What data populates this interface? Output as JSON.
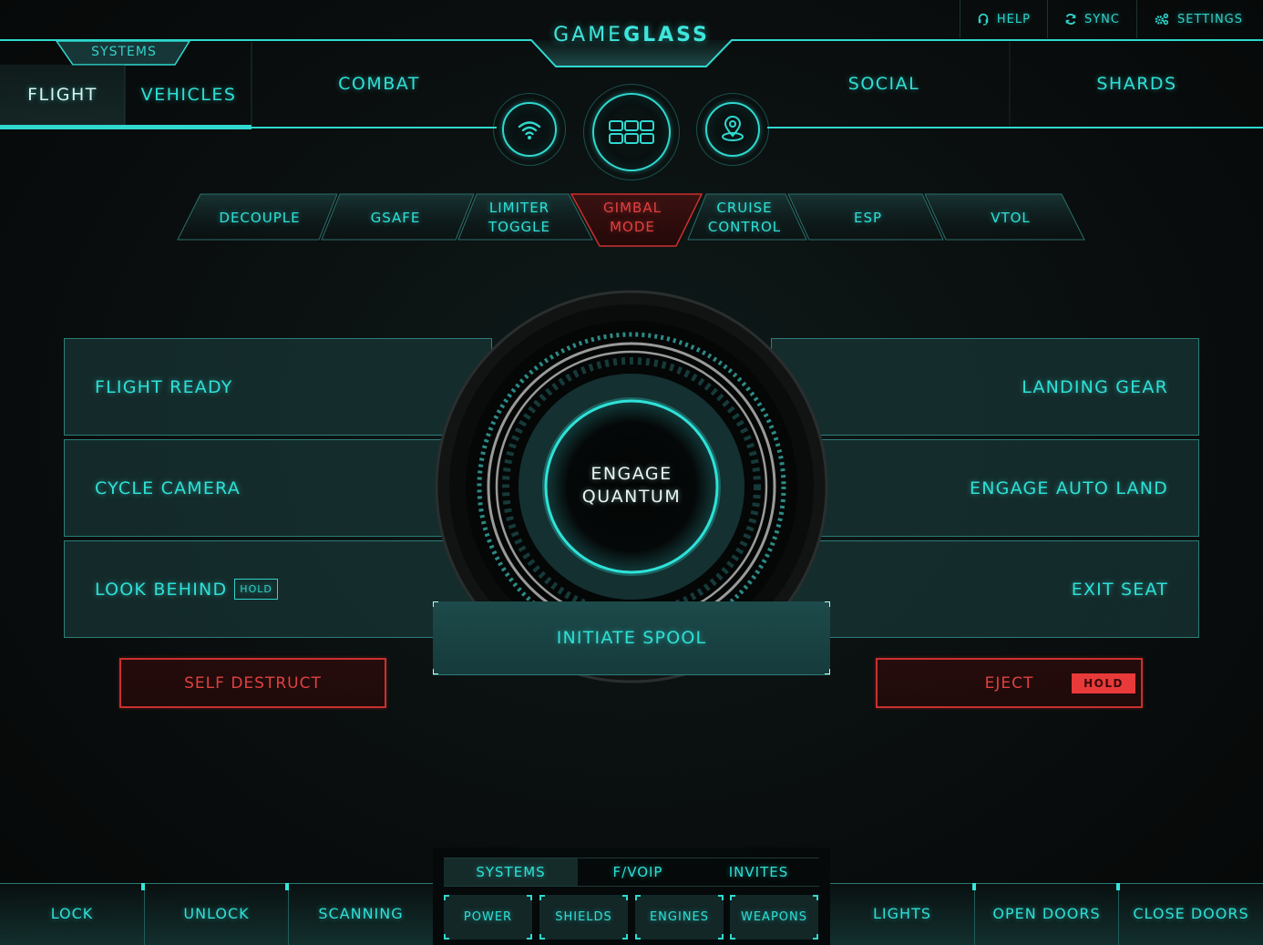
{
  "app": {
    "brand_light": "GAME",
    "brand_bold": "GLASS"
  },
  "utility": [
    {
      "label": "HELP",
      "icon": "headset-icon"
    },
    {
      "label": "SYNC",
      "icon": "sync-icon"
    },
    {
      "label": "SETTINGS",
      "icon": "gears-icon"
    }
  ],
  "nav": {
    "group_label": "SYSTEMS",
    "tabs": [
      {
        "label": "FLIGHT",
        "active": true
      },
      {
        "label": "VEHICLES",
        "active": false
      },
      {
        "label": "COMBAT",
        "active": false
      },
      {
        "label": "SOCIAL",
        "active": false
      },
      {
        "label": "SHARDS",
        "active": false
      }
    ],
    "center_icons": [
      "wifi-icon",
      "grid-icon",
      "map-pin-icon"
    ]
  },
  "toggles": [
    {
      "line1": "DECOUPLE",
      "line2": "",
      "state": "normal"
    },
    {
      "line1": "GSAFE",
      "line2": "",
      "state": "normal"
    },
    {
      "line1": "LIMITER",
      "line2": "TOGGLE",
      "state": "normal"
    },
    {
      "line1": "GIMBAL",
      "line2": "MODE",
      "state": "alert"
    },
    {
      "line1": "CRUISE",
      "line2": "CONTROL",
      "state": "normal"
    },
    {
      "line1": "ESP",
      "line2": "",
      "state": "normal"
    },
    {
      "line1": "VTOL",
      "line2": "",
      "state": "normal"
    }
  ],
  "panels": {
    "left": [
      {
        "label": "FLIGHT READY"
      },
      {
        "label": "CYCLE CAMERA"
      },
      {
        "label": "LOOK BEHIND",
        "badge": "HOLD"
      }
    ],
    "right": [
      {
        "label": "LANDING GEAR"
      },
      {
        "label": "ENGAGE AUTO LAND"
      },
      {
        "label": "EXIT SEAT"
      }
    ]
  },
  "quantum": {
    "line1": "ENGAGE",
    "line2": "QUANTUM",
    "spool_label": "INITIATE SPOOL"
  },
  "danger": {
    "self_destruct": "SELF DESTRUCT",
    "eject": "EJECT",
    "eject_badge": "HOLD"
  },
  "bottom": {
    "left": [
      "LOCK",
      "UNLOCK",
      "SCANNING"
    ],
    "right": [
      "LIGHTS",
      "OPEN DOORS",
      "CLOSE DOORS"
    ],
    "tabs": [
      {
        "label": "SYSTEMS",
        "active": true
      },
      {
        "label": "F/VOIP",
        "active": false
      },
      {
        "label": "INVITES",
        "active": false
      }
    ],
    "systems": [
      "POWER",
      "SHIELDS",
      "ENGINES",
      "WEAPONS"
    ]
  },
  "colors": {
    "accent": "#2fd9d0",
    "alert": "#e04040",
    "panel": "#183434",
    "background": "#0a0e0e"
  }
}
